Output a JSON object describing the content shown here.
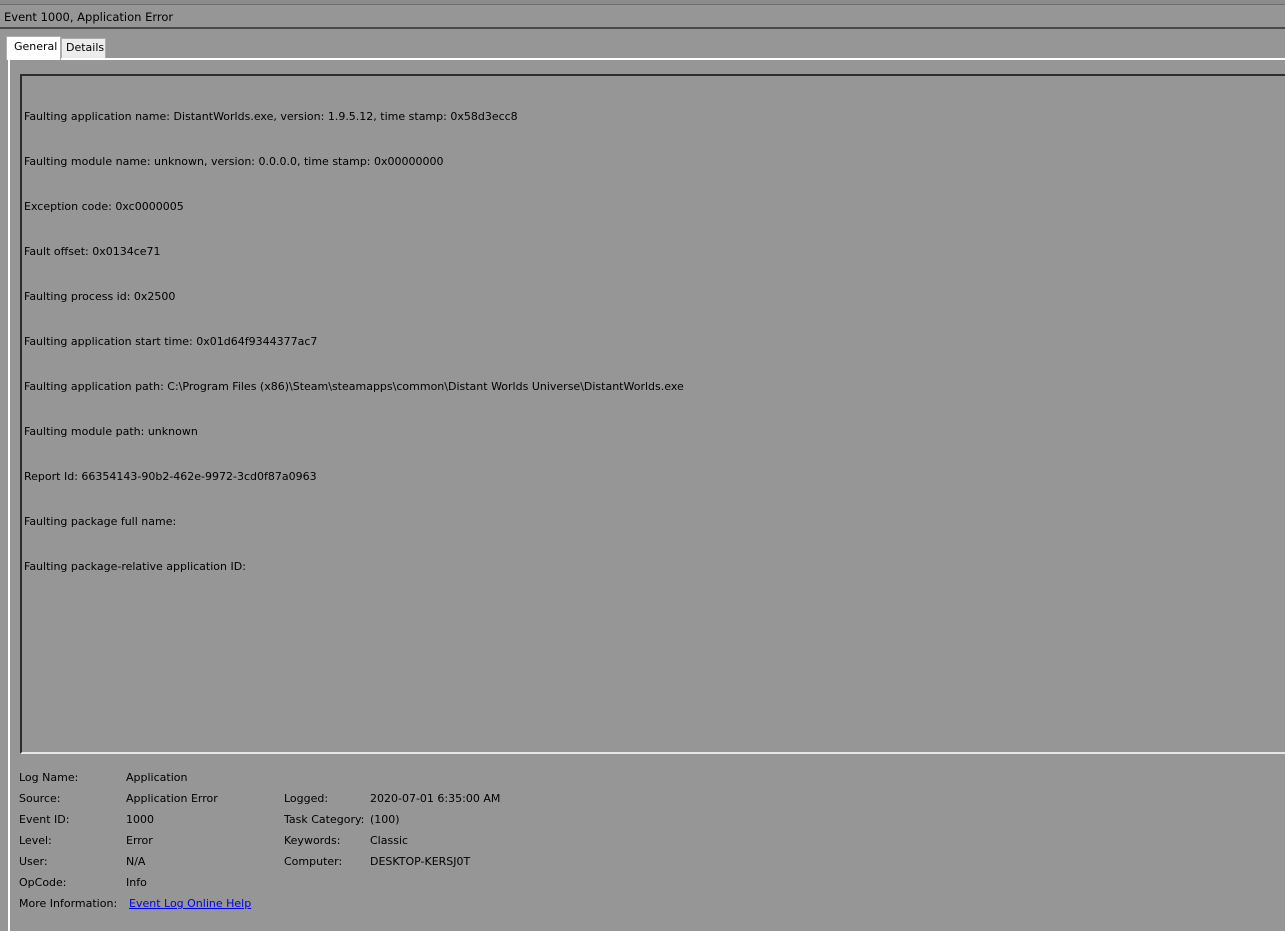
{
  "window": {
    "title": "Event 1000, Application Error"
  },
  "tabs": [
    {
      "label": "General",
      "selected": true
    },
    {
      "label": "Details",
      "selected": false
    }
  ],
  "description": [
    "Faulting application name: DistantWorlds.exe, version: 1.9.5.12, time stamp: 0x58d3ecc8",
    "Faulting module name: unknown, version: 0.0.0.0, time stamp: 0x00000000",
    "Exception code: 0xc0000005",
    "Fault offset: 0x0134ce71",
    "Faulting process id: 0x2500",
    "Faulting application start time: 0x01d64f9344377ac7",
    "Faulting application path: C:\\Program Files (x86)\\Steam\\steamapps\\common\\Distant Worlds Universe\\DistantWorlds.exe",
    "Faulting module path: unknown",
    "Report Id: 66354143-90b2-462e-9972-3cd0f87a0963",
    "Faulting package full name: ",
    "Faulting package-relative application ID: "
  ],
  "properties": {
    "log_name": {
      "label": "Log Name:",
      "value": "Application"
    },
    "source": {
      "label": "Source:",
      "value": "Application Error"
    },
    "logged": {
      "label": "Logged:",
      "value": "2020-07-01 6:35:00 AM"
    },
    "event_id": {
      "label": "Event ID:",
      "value": "1000"
    },
    "task_category": {
      "label": "Task Category:",
      "value": "(100)"
    },
    "level": {
      "label": "Level:",
      "value": "Error"
    },
    "keywords": {
      "label": "Keywords:",
      "value": "Classic"
    },
    "user": {
      "label": "User:",
      "value": "N/A"
    },
    "computer": {
      "label": "Computer:",
      "value": "DESKTOP-KERSJ0T"
    },
    "opcode": {
      "label": "OpCode:",
      "value": "Info"
    },
    "more_info": {
      "label": "More Information:",
      "link_text": "Event Log Online Help"
    }
  },
  "colors": {
    "background": "#969696",
    "link": "#0000ee"
  }
}
